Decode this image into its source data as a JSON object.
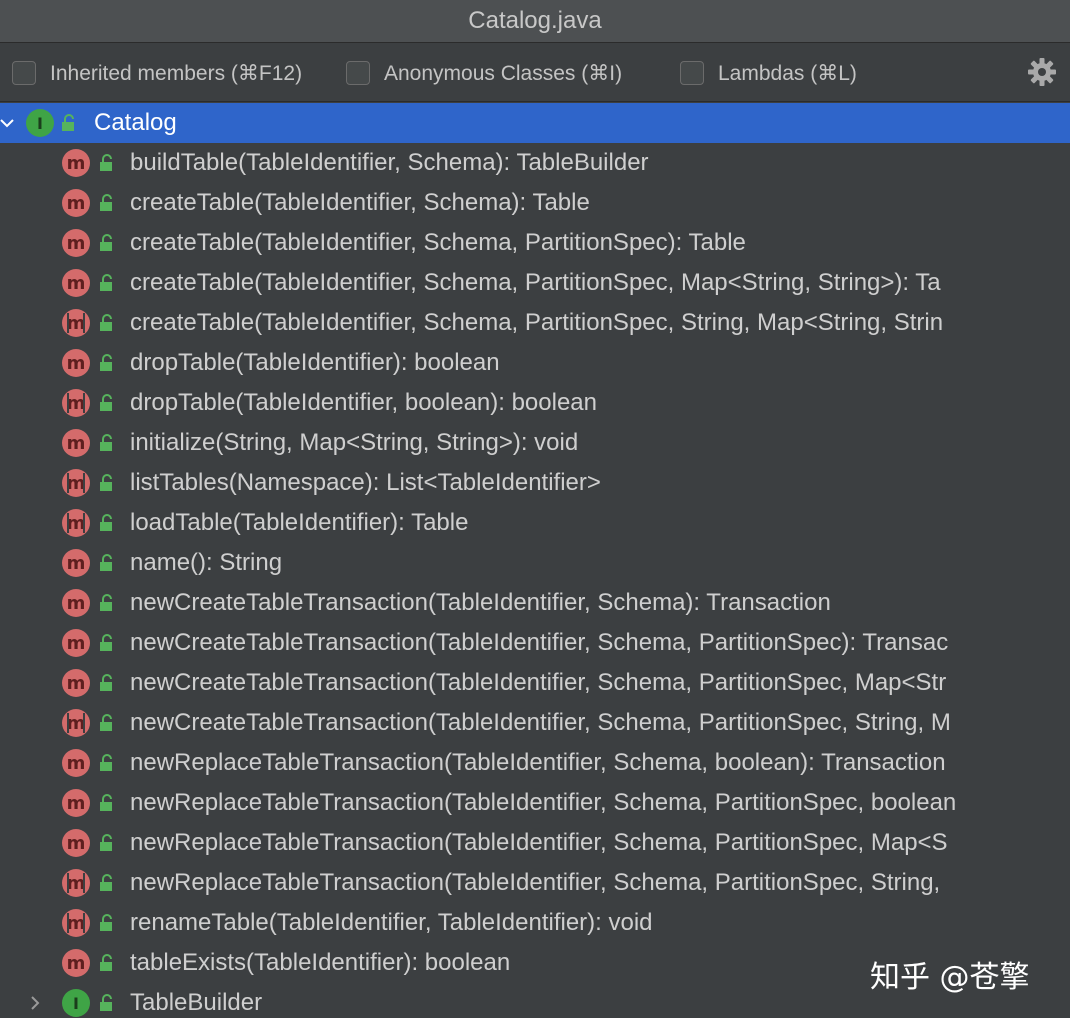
{
  "window": {
    "title": "Catalog.java"
  },
  "toolbar": {
    "inherited_label": "Inherited members (⌘F12)",
    "anonymous_label": "Anonymous Classes (⌘I)",
    "lambdas_label": "Lambdas (⌘L)"
  },
  "tree": {
    "root": {
      "label": "Catalog",
      "icon": "interface-icon",
      "expanded": true
    },
    "members": [
      {
        "label": "buildTable(TableIdentifier, Schema): TableBuilder",
        "icon": "method-icon"
      },
      {
        "label": "createTable(TableIdentifier, Schema): Table",
        "icon": "method-icon"
      },
      {
        "label": "createTable(TableIdentifier, Schema, PartitionSpec): Table",
        "icon": "method-icon"
      },
      {
        "label": "createTable(TableIdentifier, Schema, PartitionSpec, Map<String, String>): Ta",
        "icon": "method-icon"
      },
      {
        "label": "createTable(TableIdentifier, Schema, PartitionSpec, String, Map<String, Strin",
        "icon": "abstract-method-icon"
      },
      {
        "label": "dropTable(TableIdentifier): boolean",
        "icon": "method-icon"
      },
      {
        "label": "dropTable(TableIdentifier, boolean): boolean",
        "icon": "abstract-method-icon"
      },
      {
        "label": "initialize(String, Map<String, String>): void",
        "icon": "method-icon"
      },
      {
        "label": "listTables(Namespace): List<TableIdentifier>",
        "icon": "abstract-method-icon"
      },
      {
        "label": "loadTable(TableIdentifier): Table",
        "icon": "abstract-method-icon"
      },
      {
        "label": "name(): String",
        "icon": "method-icon"
      },
      {
        "label": "newCreateTableTransaction(TableIdentifier, Schema): Transaction",
        "icon": "method-icon"
      },
      {
        "label": "newCreateTableTransaction(TableIdentifier, Schema, PartitionSpec): Transac",
        "icon": "method-icon"
      },
      {
        "label": "newCreateTableTransaction(TableIdentifier, Schema, PartitionSpec, Map<Str",
        "icon": "method-icon"
      },
      {
        "label": "newCreateTableTransaction(TableIdentifier, Schema, PartitionSpec, String, M",
        "icon": "abstract-method-icon"
      },
      {
        "label": "newReplaceTableTransaction(TableIdentifier, Schema, boolean): Transaction",
        "icon": "method-icon"
      },
      {
        "label": "newReplaceTableTransaction(TableIdentifier, Schema, PartitionSpec, boolean",
        "icon": "method-icon"
      },
      {
        "label": "newReplaceTableTransaction(TableIdentifier, Schema, PartitionSpec, Map<S",
        "icon": "method-icon"
      },
      {
        "label": "newReplaceTableTransaction(TableIdentifier, Schema, PartitionSpec, String,",
        "icon": "abstract-method-icon"
      },
      {
        "label": "renameTable(TableIdentifier, TableIdentifier): void",
        "icon": "abstract-method-icon"
      },
      {
        "label": "tableExists(TableIdentifier): boolean",
        "icon": "method-icon"
      }
    ],
    "nested": {
      "label": "TableBuilder",
      "icon": "interface-icon",
      "expanded": false
    }
  },
  "watermark": "知乎 @苍擎",
  "colors": {
    "selection": "#2f65ca",
    "method_icon": "#d46b6b",
    "interface_icon": "#3fa446",
    "background": "#3c3f41"
  }
}
